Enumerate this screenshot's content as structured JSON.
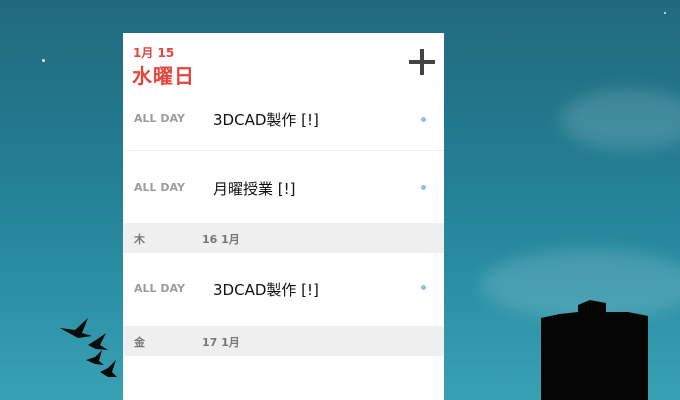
{
  "widget": {
    "date": "1月 15",
    "weekday": "水曜日",
    "add_icon": "plus-icon",
    "groups": [
      {
        "events": [
          {
            "allday_label": "ALL DAY",
            "title": "3DCAD製作 [!]"
          },
          {
            "allday_label": "ALL DAY",
            "title": "月曜授業 [!]"
          }
        ]
      },
      {
        "day_label": "木",
        "date_label": "16 1月",
        "events": [
          {
            "allday_label": "ALL DAY",
            "title": "3DCAD製作 [!]"
          }
        ]
      },
      {
        "day_label": "金",
        "date_label": "17 1月",
        "events": []
      }
    ],
    "accent_color": "#e5453b",
    "event_dot_color": "#8fbfe6"
  }
}
